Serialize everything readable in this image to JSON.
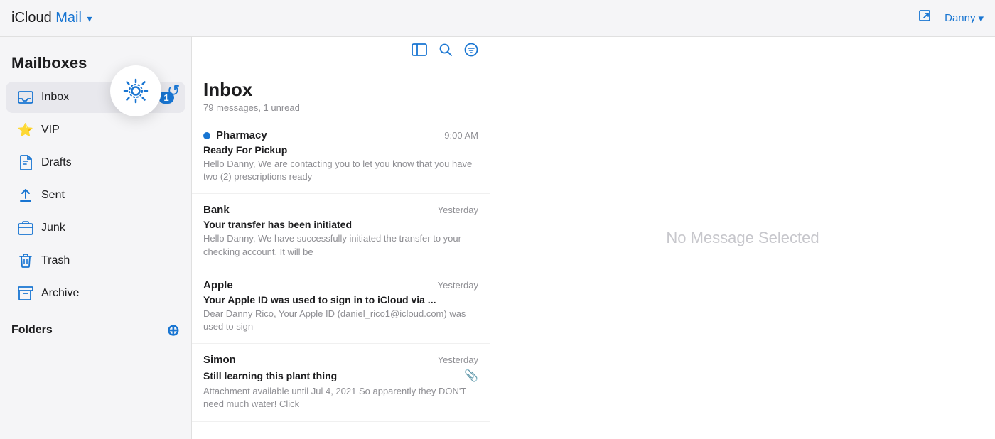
{
  "header": {
    "brand": "iCloud",
    "app": "Mail",
    "chevron": "▾",
    "compose_label": "compose",
    "user_name": "Danny",
    "user_chevron": "▾"
  },
  "sidebar": {
    "mailboxes_title": "Mailboxes",
    "items": [
      {
        "id": "inbox",
        "label": "Inbox",
        "icon": "inbox",
        "badge": "1",
        "active": true
      },
      {
        "id": "vip",
        "label": "VIP",
        "icon": "vip",
        "badge": "",
        "active": false
      },
      {
        "id": "drafts",
        "label": "Drafts",
        "icon": "drafts",
        "badge": "",
        "active": false
      },
      {
        "id": "sent",
        "label": "Sent",
        "icon": "sent",
        "badge": "",
        "active": false
      },
      {
        "id": "junk",
        "label": "Junk",
        "icon": "junk",
        "badge": "",
        "active": false
      },
      {
        "id": "trash",
        "label": "Trash",
        "icon": "trash",
        "badge": "",
        "active": false
      },
      {
        "id": "archive",
        "label": "Archive",
        "icon": "archive",
        "badge": "",
        "active": false
      }
    ],
    "folders_title": "Folders",
    "add_folder_icon": "+"
  },
  "email_list": {
    "title": "Inbox",
    "subtitle": "79 messages, 1 unread",
    "emails": [
      {
        "id": 1,
        "sender": "Pharmacy",
        "time": "9:00 AM",
        "subject": "Ready For Pickup",
        "preview": "Hello Danny, We are contacting you to let you know that you have two (2) prescriptions ready",
        "unread": true,
        "attachment": false
      },
      {
        "id": 2,
        "sender": "Bank",
        "time": "Yesterday",
        "subject": "Your transfer has been initiated",
        "preview": "Hello Danny, We have successfully initiated the transfer to your checking account. It will be",
        "unread": false,
        "attachment": false
      },
      {
        "id": 3,
        "sender": "Apple",
        "time": "Yesterday",
        "subject": "Your Apple ID was used to sign in to iCloud via ...",
        "preview": "Dear Danny Rico, Your Apple ID (daniel_rico1@icloud.com) was used to sign",
        "unread": false,
        "attachment": false
      },
      {
        "id": 4,
        "sender": "Simon",
        "time": "Yesterday",
        "subject": "Still learning this plant thing",
        "preview": "Attachment available until Jul 4, 2021 So apparently they DON'T need much water! Click",
        "unread": false,
        "attachment": true
      }
    ]
  },
  "detail": {
    "no_message": "No Message Selected"
  },
  "colors": {
    "accent": "#1875d2",
    "vip_star": "#f5a623"
  }
}
